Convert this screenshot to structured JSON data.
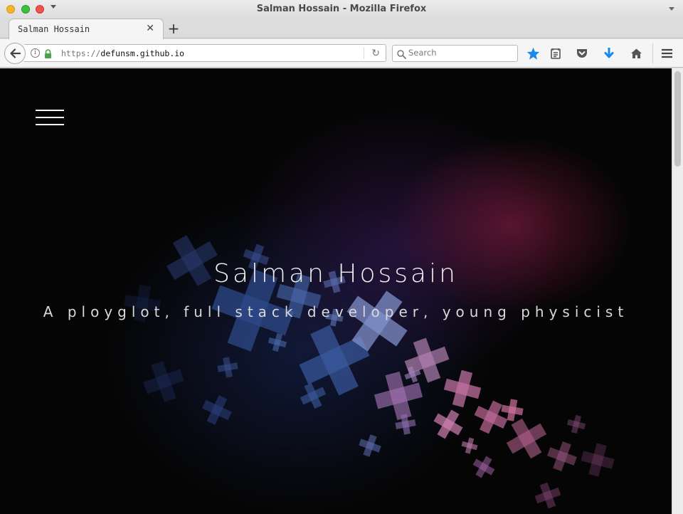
{
  "window": {
    "title": "Salman Hossain - Mozilla Firefox"
  },
  "tabs": [
    {
      "label": "Salman Hossain"
    }
  ],
  "navbar": {
    "url_protocol": "https://",
    "url_host": "defunsm.github.io",
    "search_placeholder": "Search"
  },
  "page": {
    "title": "Salman Hossain",
    "subtitle": "A ployglot, full stack developer, young physicist"
  },
  "colors": {
    "background": "#050505",
    "bookmark_star": "#1a8ae8",
    "download_arrow": "#1a8ae8",
    "secure_lock": "#47a447"
  },
  "icons": [
    "back-arrow-icon",
    "info-icon",
    "lock-icon",
    "reload-icon",
    "search-icon",
    "bookmark-star-icon",
    "reading-list-icon",
    "pocket-icon",
    "download-icon",
    "home-icon",
    "menu-icon",
    "hamburger-menu-icon"
  ]
}
